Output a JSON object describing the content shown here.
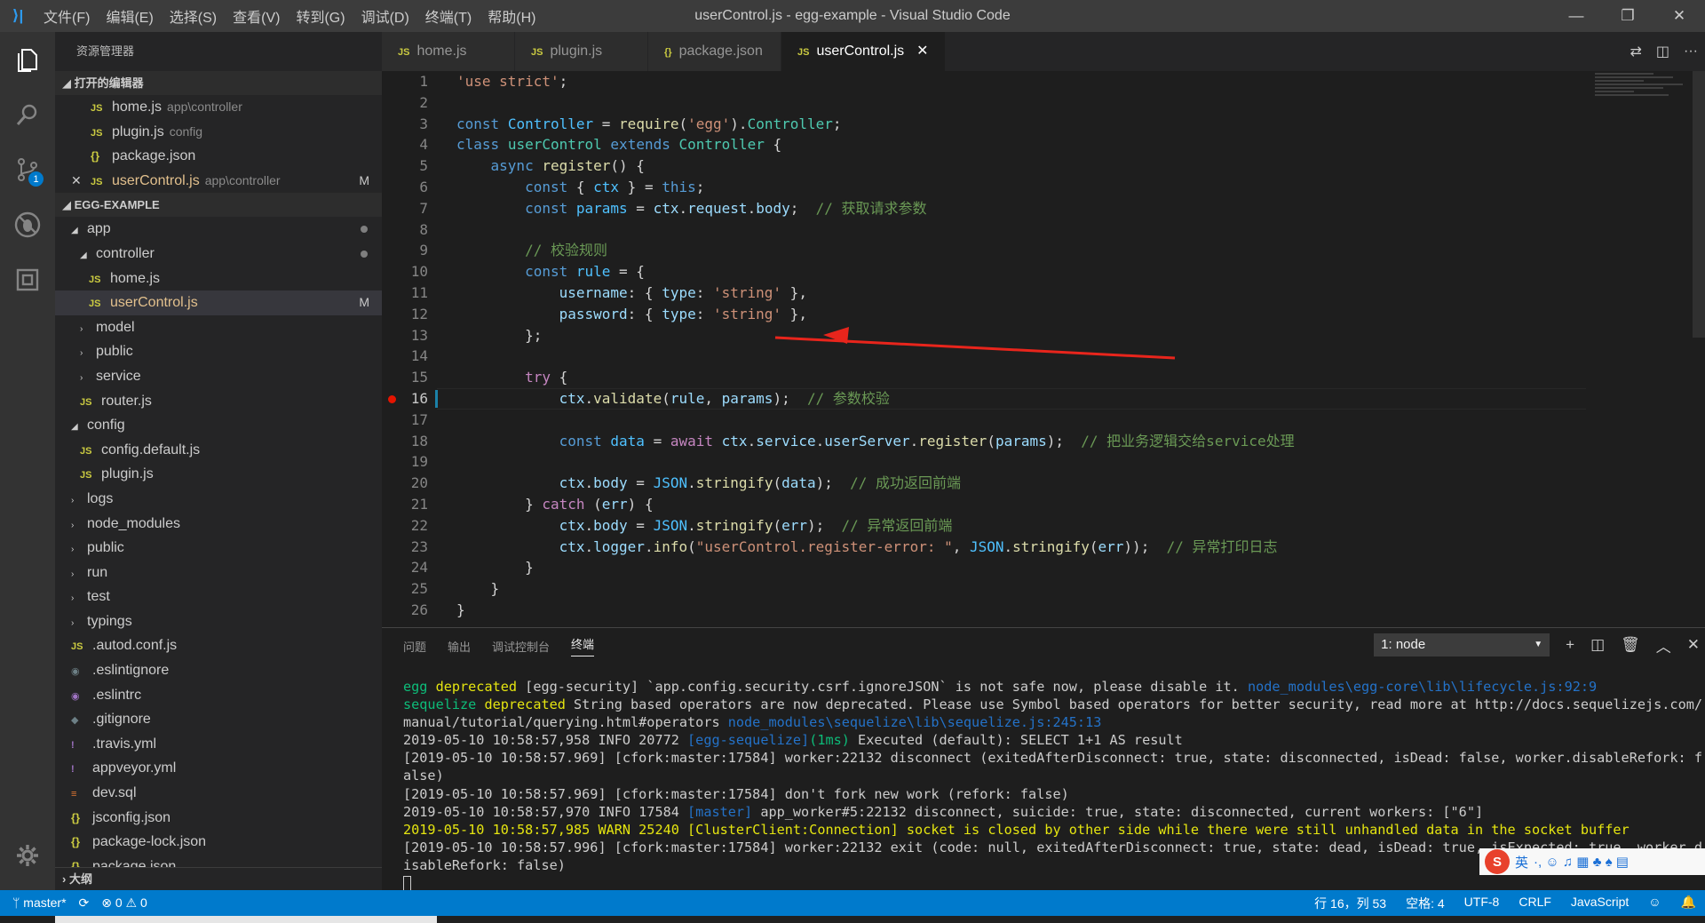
{
  "titlebar": {
    "menu": [
      "文件(F)",
      "编辑(E)",
      "选择(S)",
      "查看(V)",
      "转到(G)",
      "调试(D)",
      "终端(T)",
      "帮助(H)"
    ],
    "title": "userControl.js - egg-example - Visual Studio Code"
  },
  "activity": {
    "scm_badge": "1"
  },
  "sidebar": {
    "header": "资源管理器",
    "open_editors_title": "打开的编辑器",
    "open_editors": [
      {
        "name": "home.js",
        "desc": "app\\controller",
        "icon": "JS"
      },
      {
        "name": "plugin.js",
        "desc": "config",
        "icon": "JS"
      },
      {
        "name": "package.json",
        "desc": "",
        "icon": "{}"
      },
      {
        "name": "userControl.js",
        "desc": "app\\controller",
        "icon": "JS",
        "status": "M"
      }
    ],
    "project_title": "EGG-EXAMPLE",
    "tree": [
      {
        "name": "app",
        "level": 1,
        "twisty": "◢",
        "dot": true
      },
      {
        "name": "controller",
        "level": 2,
        "twisty": "◢",
        "dot": true
      },
      {
        "name": "home.js",
        "level": 3,
        "icon": "JS"
      },
      {
        "name": "userControl.js",
        "level": 3,
        "icon": "JS",
        "status": "M"
      },
      {
        "name": "model",
        "level": 2,
        "twisty": "›"
      },
      {
        "name": "public",
        "level": 2,
        "twisty": "›"
      },
      {
        "name": "service",
        "level": 2,
        "twisty": "›"
      },
      {
        "name": "router.js",
        "level": 2,
        "icon": "JS"
      },
      {
        "name": "config",
        "level": 1,
        "twisty": "◢"
      },
      {
        "name": "config.default.js",
        "level": 2,
        "icon": "JS"
      },
      {
        "name": "plugin.js",
        "level": 2,
        "icon": "JS"
      },
      {
        "name": "logs",
        "level": 1,
        "twisty": "›"
      },
      {
        "name": "node_modules",
        "level": 1,
        "twisty": "›"
      },
      {
        "name": "public",
        "level": 1,
        "twisty": "›"
      },
      {
        "name": "run",
        "level": 1,
        "twisty": "›"
      },
      {
        "name": "test",
        "level": 1,
        "twisty": "›"
      },
      {
        "name": "typings",
        "level": 1,
        "twisty": "›"
      },
      {
        "name": ".autod.conf.js",
        "level": 1,
        "icon": "JS"
      },
      {
        "name": ".eslintignore",
        "level": 1,
        "icon": "◉"
      },
      {
        "name": ".eslintrc",
        "level": 1,
        "icon": "◉"
      },
      {
        "name": ".gitignore",
        "level": 1,
        "icon": "◆"
      },
      {
        "name": ".travis.yml",
        "level": 1,
        "icon": "!"
      },
      {
        "name": "appveyor.yml",
        "level": 1,
        "icon": "!"
      },
      {
        "name": "dev.sql",
        "level": 1,
        "icon": "≡"
      },
      {
        "name": "jsconfig.json",
        "level": 1,
        "icon": "{}"
      },
      {
        "name": "package-lock.json",
        "level": 1,
        "icon": "{}"
      },
      {
        "name": "package.json",
        "level": 1,
        "icon": "{}"
      }
    ],
    "outline_title": "大纲"
  },
  "tabs": [
    {
      "label": "home.js",
      "icon": "JS"
    },
    {
      "label": "plugin.js",
      "icon": "JS"
    },
    {
      "label": "package.json",
      "icon": "{}"
    },
    {
      "label": "userControl.js",
      "icon": "JS",
      "active": true
    }
  ],
  "editor": {
    "current_line": 16,
    "breakpoint_line": 16,
    "lines": [
      "<span class=s>'use strict'</span>;",
      "",
      "<span class=k>const</span> <span class=cn>Controller</span> = <span class=f>require</span>(<span class=s>'egg'</span>).<span class=t>Controller</span>;",
      "<span class=k>class</span> <span class=t>userControl</span> <span class=k>extends</span> <span class=t>Controller</span> {",
      "    <span class=k>async</span> <span class=f>register</span>() {",
      "        <span class=k>const</span> { <span class=cn>ctx</span> } = <span class=k>this</span>;",
      "        <span class=k>const</span> <span class=cn>params</span> = <span class=v>ctx</span>.<span class=v>request</span>.<span class=v>body</span>;  <span class=cm>// 获取请求参数</span>",
      "",
      "        <span class=cm>// 校验规则</span>",
      "        <span class=k>const</span> <span class=cn>rule</span> = {",
      "            <span class=v>username</span>: { <span class=v>type</span>: <span class=s>'string'</span> },",
      "            <span class=v>password</span>: { <span class=v>type</span>: <span class=s>'string'</span> },",
      "        };",
      "",
      "        <span class=c>try</span> {",
      "            <span class=v>ctx</span>.<span class=f>validate</span>(<span class=v>rule</span>, <span class=v>params</span>);  <span class=cm>// 参数校验</span>",
      "",
      "            <span class=k>const</span> <span class=cn>data</span> = <span class=c>await</span> <span class=v>ctx</span>.<span class=v>service</span>.<span class=v>userServer</span>.<span class=f>register</span>(<span class=v>params</span>);  <span class=cm>// 把业务逻辑交给service处理</span>",
      "",
      "            <span class=v>ctx</span>.<span class=v>body</span> = <span class=cn>JSON</span>.<span class=f>stringify</span>(<span class=v>data</span>);  <span class=cm>// 成功返回前端</span>",
      "        } <span class=c>catch</span> (<span class=v>err</span>) {",
      "            <span class=v>ctx</span>.<span class=v>body</span> = <span class=cn>JSON</span>.<span class=f>stringify</span>(<span class=v>err</span>);  <span class=cm>// 异常返回前端</span>",
      "            <span class=v>ctx</span>.<span class=v>logger</span>.<span class=f>info</span>(<span class=s>\"userControl.register-error: \"</span>, <span class=cn>JSON</span>.<span class=f>stringify</span>(<span class=v>err</span>));  <span class=cm>// 异常打印日志</span>",
      "        }",
      "    }",
      "}"
    ]
  },
  "panel": {
    "tabs": [
      "问题",
      "输出",
      "调试控制台",
      "终端"
    ],
    "active_tab": "终端",
    "terminal_select": "1: node",
    "terminal_lines": [
      "<span class=tg>egg</span> <span class=ty>deprecated</span> [egg-security] `app.config.security.csrf.ignoreJSON` is not safe now, please disable it. <span class=tb>node_modules\\egg-core\\lib\\lifecycle.js:92:9</span>",
      "<span class=tg>sequelize</span> <span class=ty>deprecated</span> String based operators are now deprecated. Please use Symbol based operators for better security, read more at http://docs.sequelizejs.com/",
      "manual/tutorial/querying.html#operators <span class=tb>node_modules\\sequelize\\lib\\sequelize.js:245:13</span>",
      "2019-05-10 10:58:57,958 INFO 20772 <span class=tb>[egg-sequelize]</span><span class=tg>(1ms)</span> Executed (default): SELECT 1+1 AS result",
      "[2019-05-10 10:58:57.969] [cfork:master:17584] worker:22132 disconnect (exitedAfterDisconnect: true, state: disconnected, isDead: false, worker.disableRefork: f",
      "alse)",
      "[2019-05-10 10:58:57.969] [cfork:master:17584] don't fork new work (refork: false)",
      "2019-05-10 10:58:57,970 INFO 17584 <span class=tb>[master]</span> app_worker#5:22132 disconnect, suicide: true, state: disconnected, current workers: [\"6\"]",
      "<span class=ty>2019-05-10 10:58:57,985 WARN 25240 [ClusterClient:Connection] socket is closed by other side while there were still unhandled data in the socket buffer</span>",
      "[2019-05-10 10:58:57.996] [cfork:master:17584] worker:22132 exit (code: null, exitedAfterDisconnect: true, state: dead, isDead: true, isExpected: true, worker.d",
      "isableRefork: false)"
    ]
  },
  "ime": {
    "lang": "英",
    "glyphs": "·, ☺ ♫ ▦ ♣ ♠ ▤"
  },
  "statusbar": {
    "branch": "master*",
    "sync": "⟳",
    "problems": "⊗ 0 ⚠ 0",
    "cursor": "行 16，列 53",
    "indent": "空格: 4",
    "encoding": "UTF-8",
    "eol": "CRLF",
    "language": "JavaScript"
  }
}
